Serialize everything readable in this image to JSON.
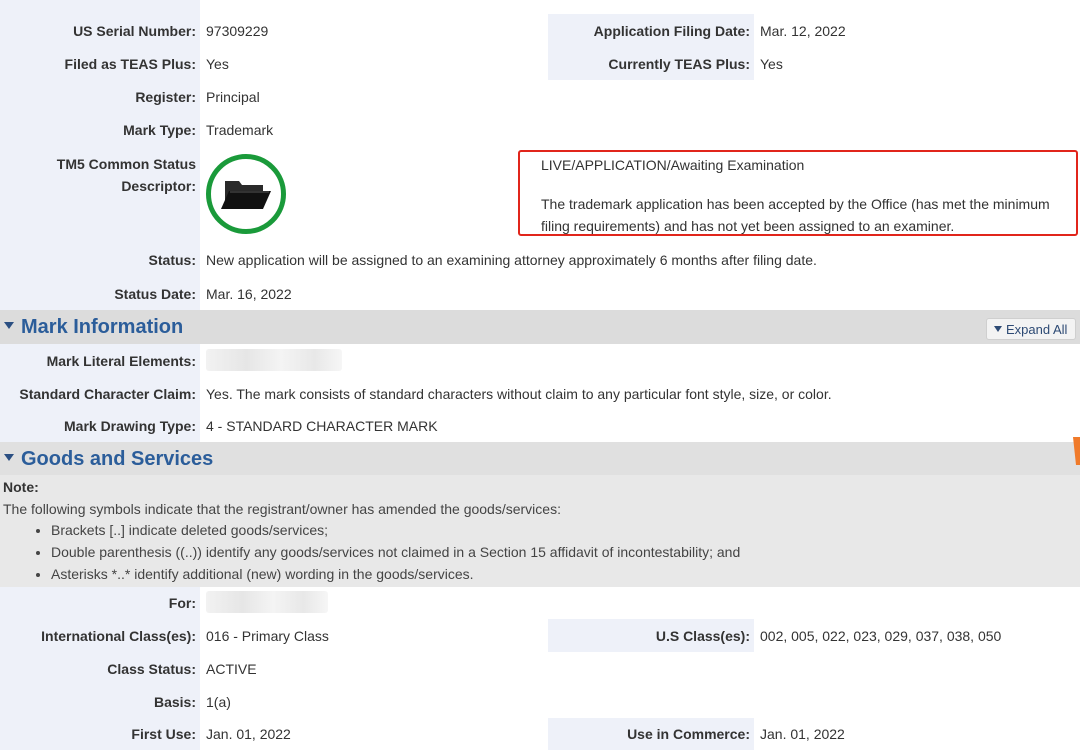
{
  "status_section": {
    "rows": {
      "serial_label": "US Serial Number:",
      "serial_value": "97309229",
      "filing_date_label": "Application Filing Date:",
      "filing_date_value": "Mar. 12, 2022",
      "teas_filed_label": "Filed as TEAS Plus:",
      "teas_filed_value": "Yes",
      "teas_current_label": "Currently TEAS Plus:",
      "teas_current_value": "Yes",
      "register_label": "Register:",
      "register_value": "Principal",
      "mark_type_label": "Mark Type:",
      "mark_type_value": "Trademark",
      "tm5_label_1": "TM5 Common Status",
      "tm5_label_2": "Descriptor:",
      "tm5_icon": "folder-icon",
      "tm5_title": "LIVE/APPLICATION/Awaiting Examination",
      "tm5_desc_1": "The trademark application has been accepted by the Office (has met the minimum",
      "tm5_desc_2": "filing requirements) and has not yet been assigned to an examiner.",
      "status_label": "Status:",
      "status_value": "New application will be assigned to an examining attorney approximately 6 months after filing date.",
      "status_date_label": "Status Date:",
      "status_date_value": "Mar. 16, 2022"
    }
  },
  "mark_information": {
    "title": "Mark Information",
    "expand_all": "Expand All",
    "literal_label": "Mark Literal Elements:",
    "std_char_label": "Standard Character Claim:",
    "std_char_value": "Yes. The mark consists of standard characters without claim to any particular font style, size, or color.",
    "drawing_type_label": "Mark Drawing Type:",
    "drawing_type_value": "4 - STANDARD CHARACTER MARK"
  },
  "goods_services": {
    "title": "Goods and Services",
    "note_title": "Note:",
    "note_text": "The following symbols indicate that the registrant/owner has amended the goods/services:",
    "note_items": [
      "Brackets [..] indicate deleted goods/services;",
      "Double parenthesis ((..)) identify any goods/services not claimed in a Section 15 affidavit of incontestability; and",
      "Asterisks *..* identify additional (new) wording in the goods/services."
    ],
    "for_label": "For:",
    "intl_class_label": "International Class(es):",
    "intl_class_value": "016 - Primary Class",
    "us_class_label": "U.S Class(es):",
    "us_class_value": "002, 005, 022, 023, 029, 037, 038, 050",
    "class_status_label": "Class Status:",
    "class_status_value": "ACTIVE",
    "basis_label": "Basis:",
    "basis_value": "1(a)",
    "first_use_label": "First Use:",
    "first_use_value": "Jan. 01, 2022",
    "commerce_label": "Use in Commerce:",
    "commerce_value": "Jan. 01, 2022"
  },
  "colors": {
    "label_bg": "#eef1f9",
    "section_title": "#2b5d9a",
    "highlight_border": "#e1251b",
    "icon_ring": "#1a9a3a"
  }
}
